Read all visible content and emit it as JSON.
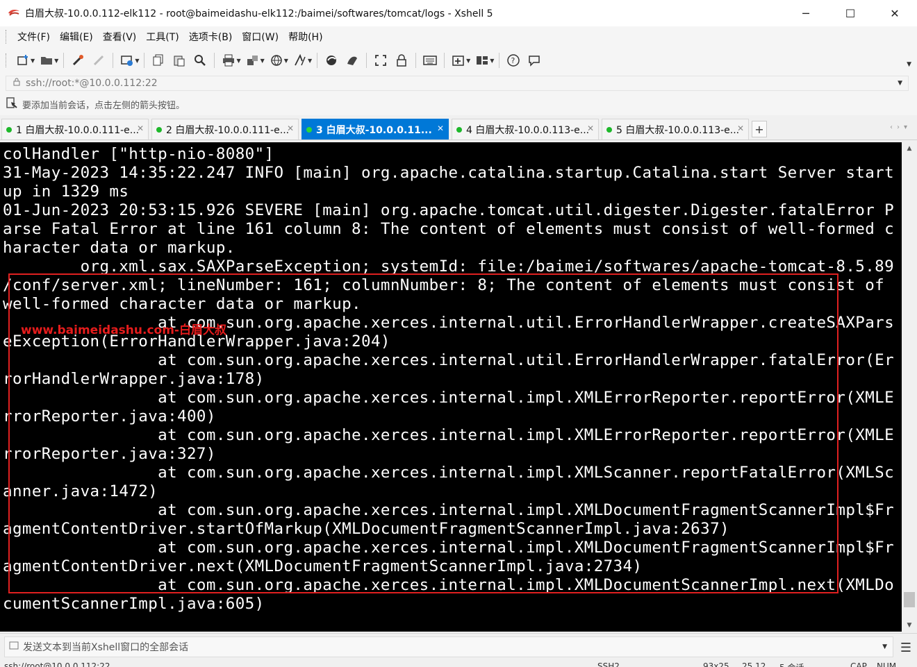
{
  "window": {
    "title": "白眉大叔-10.0.0.112-elk112 - root@baimeidashu-elk112:/baimei/softwares/tomcat/logs - Xshell 5",
    "minimize_glyph": "─",
    "maximize_glyph": "☐",
    "close_glyph": "✕"
  },
  "menu": [
    "文件(F)",
    "编辑(E)",
    "查看(V)",
    "工具(T)",
    "选项卡(B)",
    "窗口(W)",
    "帮助(H)"
  ],
  "toolbar": {
    "icons": [
      "new-session-icon",
      "open-folder-icon",
      "reconnect-icon",
      "disconnect-icon",
      "properties-icon",
      "copy-icon",
      "paste-icon",
      "find-icon",
      "print-icon",
      "transfer-icon",
      "globe-icon",
      "font-icon",
      "xftp-icon",
      "xmanager-icon",
      "fullscreen-icon",
      "lock-icon",
      "keyboard-icon",
      "add-tab-icon",
      "layout-icon",
      "help-icon",
      "chat-icon"
    ]
  },
  "address": {
    "text": "ssh://root:*@10.0.0.112:22"
  },
  "hint": {
    "text": "要添加当前会话，点击左侧的箭头按钮。"
  },
  "tabs": [
    {
      "label": "1 白眉大叔-10.0.0.111-e...",
      "active": false
    },
    {
      "label": "2 白眉大叔-10.0.0.111-e...",
      "active": false
    },
    {
      "label": "3 白眉大叔-10.0.0.11...",
      "active": true
    },
    {
      "label": "4 白眉大叔-10.0.0.113-e...",
      "active": false
    },
    {
      "label": "5 白眉大叔-10.0.0.113-e...",
      "active": false
    }
  ],
  "terminal": {
    "lines": [
      "colHandler [\"http-nio-8080\"]",
      "31-May-2023 14:35:22.247 INFO [main] org.apache.catalina.startup.Catalina.start Server start",
      "up in 1329 ms",
      "01-Jun-2023 20:53:15.926 SEVERE [main] org.apache.tomcat.util.digester.Digester.fatalError P",
      "arse Fatal Error at line 161 column 8: The content of elements must consist of well-formed c",
      "haracter data or markup.",
      "        org.xml.sax.SAXParseException; systemId: file:/baimei/softwares/apache-tomcat-8.5.89",
      "/conf/server.xml; lineNumber: 161; columnNumber: 8; The content of elements must consist of",
      "well-formed character data or markup.",
      "                at com.sun.org.apache.xerces.internal.util.ErrorHandlerWrapper.createSAXPars",
      "eException(ErrorHandlerWrapper.java:204)",
      "                at com.sun.org.apache.xerces.internal.util.ErrorHandlerWrapper.fatalError(Er",
      "rorHandlerWrapper.java:178)",
      "                at com.sun.org.apache.xerces.internal.impl.XMLErrorReporter.reportError(XMLE",
      "rrorReporter.java:400)",
      "                at com.sun.org.apache.xerces.internal.impl.XMLErrorReporter.reportError(XMLE",
      "rrorReporter.java:327)",
      "                at com.sun.org.apache.xerces.internal.impl.XMLScanner.reportFatalError(XMLSc",
      "anner.java:1472)",
      "                at com.sun.org.apache.xerces.internal.impl.XMLDocumentFragmentScannerImpl$Fr",
      "agmentContentDriver.startOfMarkup(XMLDocumentFragmentScannerImpl.java:2637)",
      "                at com.sun.org.apache.xerces.internal.impl.XMLDocumentFragmentScannerImpl$Fr",
      "agmentContentDriver.next(XMLDocumentFragmentScannerImpl.java:2734)",
      "                at com.sun.org.apache.xerces.internal.impl.XMLDocumentScannerImpl.next(XMLDo",
      "cumentScannerImpl.java:605)"
    ],
    "watermark": "www.baimeidashu.com-白眉大叔",
    "highlight_color": "#e02020"
  },
  "sendbar": {
    "text": "发送文本到当前Xshell窗口的全部会话"
  },
  "statusbar": {
    "connection": "ssh://root@10.0.0.112:22",
    "protocol": "SSH2",
    "size": "93x25",
    "cursor": "25,12",
    "sessions": "5 会话",
    "caps": "CAP",
    "num": "NUM"
  },
  "colors": {
    "accent": "#0078d7",
    "terminal_bg": "#000000",
    "terminal_fg": "#ffffff",
    "tab_dot": "#1db82a"
  }
}
